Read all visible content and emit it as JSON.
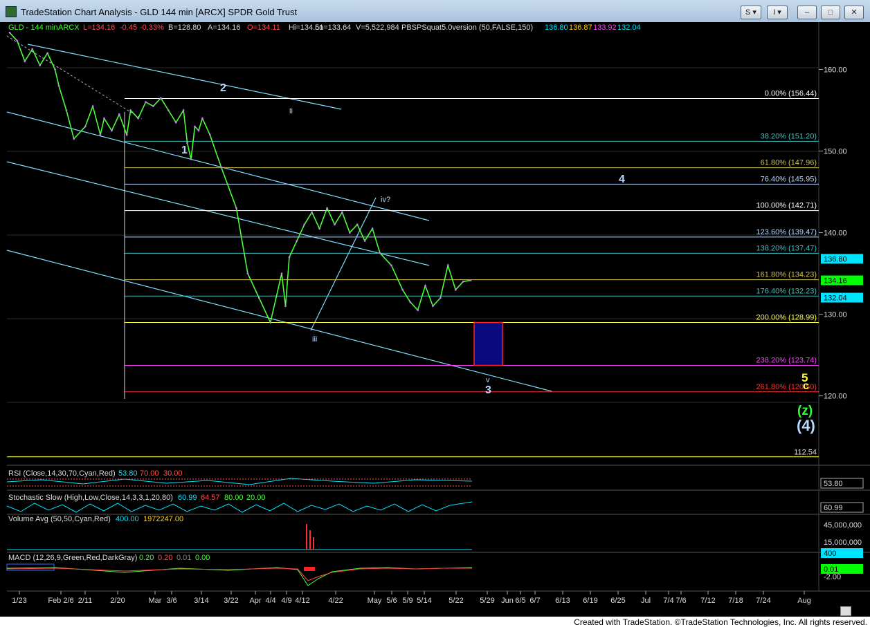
{
  "window": {
    "title": "TradeStation Chart Analysis - GLD 144 min [ARCX] SPDR Gold Trust",
    "buttons": [
      "S ▾",
      "I ▾"
    ]
  },
  "header": {
    "symbol": "GLD - 144 min",
    "exchange": "ARCX",
    "L": "L=134.16",
    "change": "-0.45",
    "pct": "-0.33%",
    "B": "B=128.80",
    "A": "A=134.16",
    "O": "O=134.11",
    "H": "Hi=134.51",
    "Lo": "Lo=133.64",
    "V": "V=5,522,984",
    "study": "PBSPSquat5.0version (50,FALSE,150)",
    "study_vals": [
      "136.80",
      "136.87",
      "133.92",
      "132.04"
    ],
    "study_colors": [
      "#00e5ff",
      "#ffd200",
      "#ff44ff",
      "#00e5ff"
    ]
  },
  "chart_data": {
    "type": "line",
    "title": "GLD - 144 min",
    "x_ticks": [
      "1/23",
      "Feb 2/6",
      "2/11",
      "2/20",
      "Mar",
      "3/6",
      "3/14",
      "3/22",
      "Apr",
      "4/4",
      "4/9",
      "4/12",
      "4/22",
      "May",
      "5/6",
      "5/9",
      "5/14",
      "5/22",
      "5/29",
      "Jun",
      "6/5",
      "6/7",
      "6/13",
      "6/19",
      "6/25",
      "Jul",
      "7/4",
      "7/6",
      "7/12",
      "7/18",
      "7/24",
      "Aug"
    ],
    "y_ticks": [
      160,
      150,
      140,
      130,
      120
    ],
    "ylim": [
      111.5,
      165.8
    ],
    "series": [
      {
        "color": "#4cff3a",
        "x": [
          0,
          2,
          4,
          6,
          8,
          10,
          12,
          13,
          15,
          17,
          20,
          22,
          24,
          25,
          27,
          29,
          31,
          32,
          34,
          36,
          38,
          40,
          42,
          44,
          46,
          47,
          48,
          49,
          50,
          51,
          53,
          56,
          60,
          63,
          66,
          69,
          72,
          73,
          74,
          76,
          78,
          80,
          82,
          84,
          86,
          88,
          90,
          92,
          94,
          96,
          98,
          101,
          104,
          106,
          108,
          110,
          112,
          114,
          116,
          118,
          120,
          122
        ],
        "y": [
          164.5,
          163.5,
          161.0,
          162.5,
          160.5,
          162.0,
          160.0,
          158.0,
          155.0,
          151.5,
          153.0,
          155.5,
          152.0,
          154.0,
          152.5,
          154.5,
          152.0,
          155.0,
          154.0,
          156.0,
          155.5,
          156.5,
          155.0,
          153.5,
          155.0,
          151.0,
          149.0,
          153.0,
          152.5,
          154.0,
          152.0,
          148.0,
          143.0,
          135.0,
          132.0,
          129.0,
          135.0,
          131.0,
          137.0,
          139.0,
          141.0,
          142.5,
          140.5,
          143.0,
          141.0,
          142.5,
          140.0,
          141.0,
          139.0,
          140.5,
          137.5,
          136.0,
          133.0,
          131.5,
          130.5,
          133.5,
          131.0,
          132.0,
          136.0,
          133.0,
          134.0,
          134.16
        ]
      }
    ],
    "fib_levels": [
      {
        "label": "0.00% (156.44)",
        "value": 156.44,
        "color": "#ffffff"
      },
      {
        "label": "38.20% (151.20)",
        "value": 151.2,
        "color": "#40c0c0"
      },
      {
        "label": "61.80% (147.96)",
        "value": 147.96,
        "color": "#d4c14a"
      },
      {
        "label": "76.40% (145.95)",
        "value": 145.95,
        "color": "#b8d8ff"
      },
      {
        "label": "100.00% (142.71)",
        "value": 142.71,
        "color": "#ffffff"
      },
      {
        "label": "123.60% (139.47)",
        "value": 139.47,
        "color": "#b8d8ff"
      },
      {
        "label": "138.20% (137.47)",
        "value": 137.47,
        "color": "#40c0c0"
      },
      {
        "label": "161.80% (134.23)",
        "value": 134.23,
        "color": "#d4c14a"
      },
      {
        "label": "176.40% (132.23)",
        "value": 132.23,
        "color": "#40c0c0"
      },
      {
        "label": "200.00% (128.99)",
        "value": 128.99,
        "color": "#ffff40"
      },
      {
        "label": "238.20% (123.74)",
        "value": 123.74,
        "color": "#ff40ff"
      },
      {
        "label": "261.80% (120.50)",
        "value": 120.5,
        "color": "#ff3030"
      }
    ],
    "price_tags": [
      {
        "label": "136.80",
        "value": 136.8,
        "bg": "#00e5ff"
      },
      {
        "label": "134.16",
        "value": 134.16,
        "bg": "#00ff00"
      },
      {
        "label": "132.04",
        "value": 132.04,
        "bg": "#00e5ff"
      }
    ],
    "extra_level": {
      "label": "112.54",
      "value": 112.54,
      "color": "#ffff40"
    },
    "target_box": {
      "y_top": 128.99,
      "y_bottom": 123.74,
      "color": "#0a0a80",
      "border": "#ff2020"
    },
    "wave_labels": [
      {
        "text": "1",
        "color": "#b8d8ff"
      },
      {
        "text": "2",
        "color": "#b8d8ff"
      },
      {
        "text": "ii",
        "color": "#b8d8ff"
      },
      {
        "text": "iv?",
        "color": "#b8d8ff"
      },
      {
        "text": "iii",
        "color": "#b8d8ff"
      },
      {
        "text": "v",
        "color": "#b8d8ff"
      },
      {
        "text": "3",
        "color": "#b8d8ff"
      },
      {
        "text": "4",
        "color": "#b8d8ff"
      },
      {
        "text": "5",
        "color": "#b8d8ff"
      },
      {
        "text": "c",
        "color": "#ffff40"
      },
      {
        "text": "(z)",
        "color": "#ffff40"
      },
      {
        "text": "(4)",
        "color": "#30ff30"
      }
    ]
  },
  "indicators": {
    "rsi": {
      "label": "RSI (Close,14,30,70,Cyan,Red)",
      "v1": "53.80",
      "v2": "70.00",
      "v3": "30.00",
      "tag": "53.80"
    },
    "stoch": {
      "label": "Stochastic Slow (High,Low,Close,14,3,3,1,20,80)",
      "v1": "60.99",
      "v2": "64.57",
      "v3": "80.00",
      "v4": "20.00",
      "tag": "60.99"
    },
    "volume": {
      "label": "Volume Avg (50,50,Cyan,Red)",
      "v1": "400.00",
      "v2": "1972247.00",
      "tag": "400",
      "ticks": [
        "45,000,000",
        "15,000,000"
      ]
    },
    "macd": {
      "label": "MACD (12,26,9,Green,Red,DarkGray)",
      "v1": "0.20",
      "v2": "0.20",
      "v3": "0.01",
      "v4": "0.00",
      "tag": "0.01",
      "tick": "-2.00"
    }
  },
  "footer": "Created with TradeStation. ©TradeStation Technologies, Inc. All rights reserved."
}
